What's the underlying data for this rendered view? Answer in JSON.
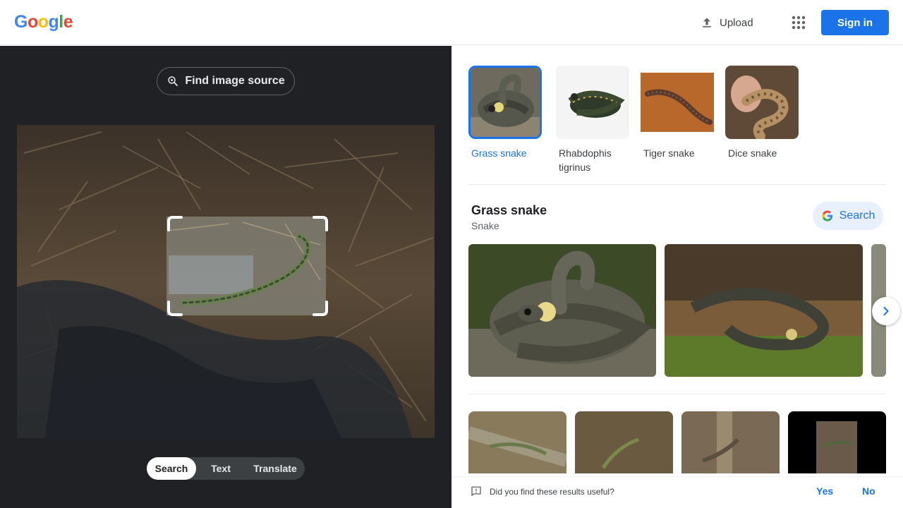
{
  "header": {
    "logo_letters": [
      "G",
      "o",
      "o",
      "g",
      "l",
      "e"
    ],
    "logo_colors": [
      "#4285f4",
      "#ea4335",
      "#fbbc05",
      "#4285f4",
      "#34a853",
      "#ea4335"
    ],
    "upload_label": "Upload",
    "upload_icon": "upload-icon",
    "apps_icon": "apps-grid-icon",
    "signin_label": "Sign in"
  },
  "lens": {
    "find_source_label": "Find image source",
    "find_source_icon": "lens-search-icon",
    "modes": [
      {
        "label": "Search",
        "active": true
      },
      {
        "label": "Text",
        "active": false
      },
      {
        "label": "Translate",
        "active": false
      }
    ]
  },
  "results": {
    "visual_matches": [
      {
        "label": "Grass snake",
        "selected": true
      },
      {
        "label": "Rhabdophis tigrinus",
        "selected": false
      },
      {
        "label": "Tiger snake",
        "selected": false
      },
      {
        "label": "Dice snake",
        "selected": false
      }
    ],
    "entity": {
      "title": "Grass snake",
      "subtitle": "Snake",
      "search_label": "Search",
      "search_icon": "google-g-icon"
    },
    "next_icon": "chevron-right-icon"
  },
  "feedback": {
    "question": "Did you find these results useful?",
    "yes": "Yes",
    "no": "No",
    "icon": "feedback-icon"
  },
  "colors": {
    "accent": "#1a73e8",
    "dark_pane": "#202124",
    "selected_chip_bg": "#e8f0fe"
  }
}
